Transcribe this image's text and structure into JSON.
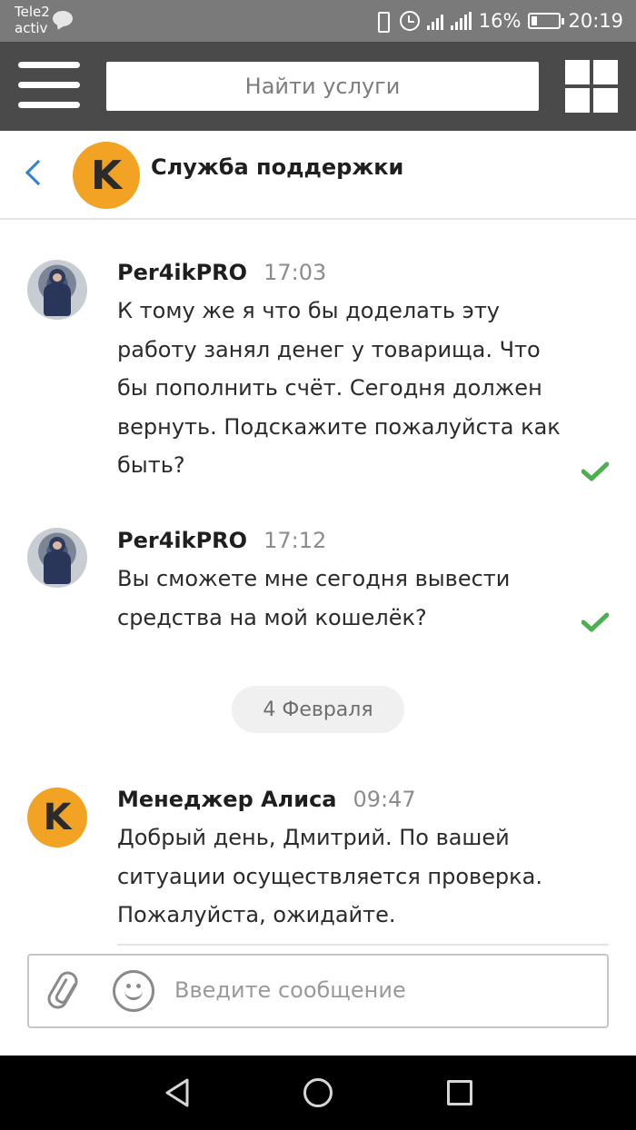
{
  "status_bar": {
    "carrier_line1": "Tele2",
    "carrier_line2": "activ",
    "battery": "16%",
    "time": "20:19"
  },
  "app_bar": {
    "search_placeholder": "Найти услуги"
  },
  "chat_header": {
    "logo_letter": "K",
    "title": "Служба поддержки"
  },
  "messages": [
    {
      "author": "Per4ikPRO",
      "time": "17:03",
      "text": "К тому же я что бы доделать эту работу занял денег у товарища. Что бы пополнить счёт. Сегодня должен вернуть. Подскажите пожалуйста как быть?",
      "read": true
    },
    {
      "author": "Per4ikPRO",
      "time": "17:12",
      "text": "Вы сможете мне сегодня вывести средства на мой кошелёк?",
      "read": true
    },
    {
      "author": "Менеджер Алиса",
      "time": "09:47",
      "text": "Добрый день, Дмитрий. По вашей ситуации осуществляется проверка. Пожалуйста, ожидайте.",
      "logo_letter": "K"
    }
  ],
  "date_separator": "4 Февраля",
  "composer": {
    "placeholder": "Введите сообщение"
  },
  "colors": {
    "brand_orange": "#f2a324",
    "check_green": "#4caf50",
    "back_blue": "#2f7fd8",
    "appbar_gray": "#4a4a4a"
  },
  "icons": [
    "speech-bubble-icon",
    "vibrate-icon",
    "alarm-icon",
    "signal-icon",
    "battery-icon",
    "menu-icon",
    "grid-icon",
    "back-arrow-icon",
    "checkmark-icon",
    "paperclip-icon",
    "smiley-icon",
    "nav-back-icon",
    "nav-home-icon",
    "nav-recent-icon"
  ]
}
